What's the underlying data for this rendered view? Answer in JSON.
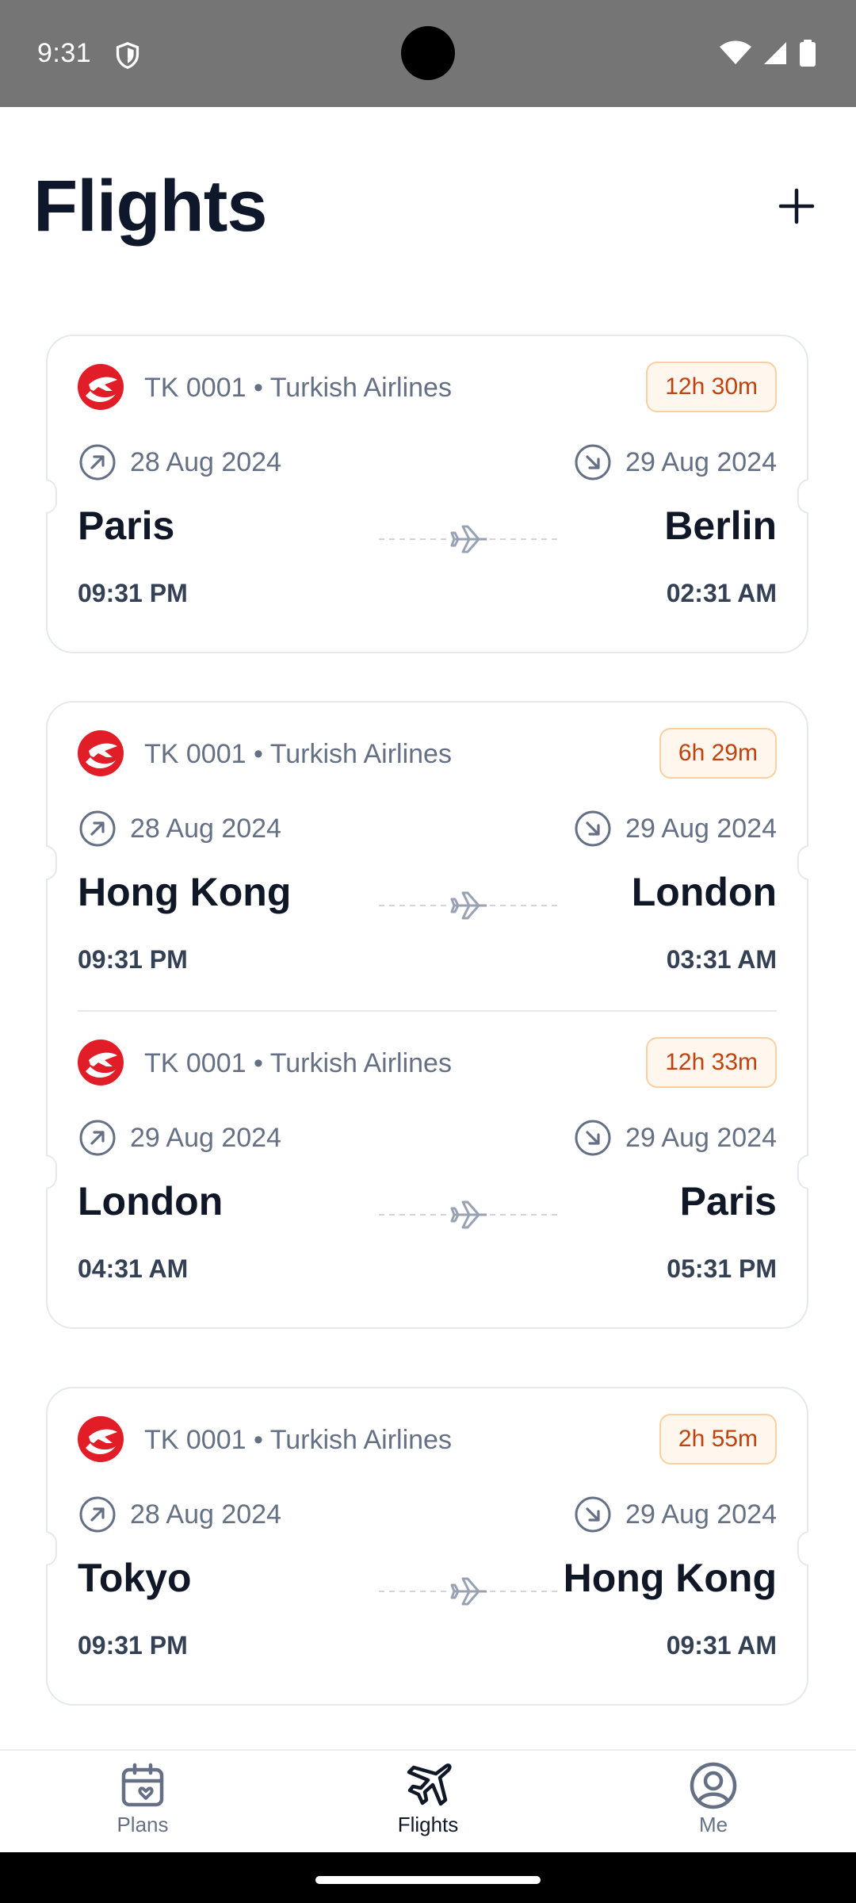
{
  "status_bar": {
    "time": "9:31",
    "icons": [
      "shield-icon",
      "wifi-icon",
      "signal-icon",
      "battery-icon"
    ]
  },
  "header": {
    "title": "Flights",
    "add_icon": "plus-icon"
  },
  "cards": [
    {
      "segments": [
        {
          "airline": "TK 0001 • Turkish Airlines",
          "duration": "12h 30m",
          "departure_date": "28 Aug 2024",
          "arrival_date": "29 Aug 2024",
          "from": "Paris",
          "to": "Berlin",
          "departure_time": "09:31 PM",
          "arrival_time": "02:31 AM"
        }
      ]
    },
    {
      "segments": [
        {
          "airline": "TK 0001 • Turkish Airlines",
          "duration": "6h 29m",
          "departure_date": "28 Aug 2024",
          "arrival_date": "29 Aug 2024",
          "from": "Hong Kong",
          "to": "London",
          "departure_time": "09:31 PM",
          "arrival_time": "03:31 AM"
        },
        {
          "airline": "TK 0001 • Turkish Airlines",
          "duration": "12h 33m",
          "departure_date": "29 Aug 2024",
          "arrival_date": "29 Aug 2024",
          "from": "London",
          "to": "Paris",
          "departure_time": "04:31 AM",
          "arrival_time": "05:31 PM"
        }
      ]
    },
    {
      "segments": [
        {
          "airline": "TK 0001 • Turkish Airlines",
          "duration": "2h 55m",
          "departure_date": "28 Aug 2024",
          "arrival_date": "29 Aug 2024",
          "from": "Tokyo",
          "to": "Hong Kong",
          "departure_time": "09:31 PM",
          "arrival_time": "09:31 AM"
        }
      ]
    }
  ],
  "bottom_nav": {
    "items": [
      {
        "label": "Plans",
        "icon": "calendar-heart-icon",
        "active": false
      },
      {
        "label": "Flights",
        "icon": "airplane-icon",
        "active": true
      },
      {
        "label": "Me",
        "icon": "user-circle-icon",
        "active": false
      }
    ]
  },
  "colors": {
    "duration_text": "#c2410c",
    "duration_bg": "#fff7ed",
    "airline_logo": "#e11d28",
    "status_bar": "#757575"
  }
}
